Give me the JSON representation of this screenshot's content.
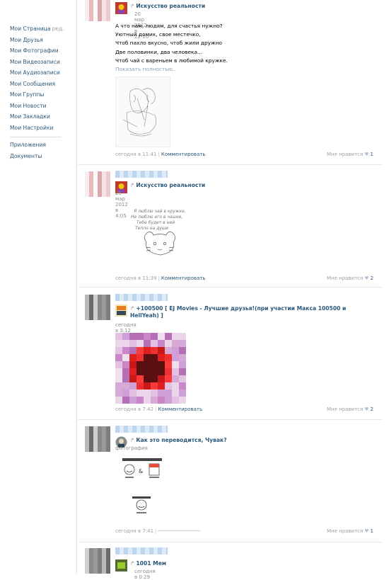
{
  "sidebar": {
    "items": [
      {
        "label": "Мои Страница",
        "extra": "ред."
      },
      {
        "label": "Мои Друзья"
      },
      {
        "label": "Мои Фотографии"
      },
      {
        "label": "Мои Видеозаписи"
      },
      {
        "label": "Мои Аудиозаписи"
      },
      {
        "label": "Мои Сообщения"
      },
      {
        "label": "Мои Группы"
      },
      {
        "label": "Мои Новости"
      },
      {
        "label": "Мои Закладки"
      },
      {
        "label": "Мои Настройки"
      }
    ],
    "secondary": [
      {
        "label": "Приложения"
      },
      {
        "label": "Документы"
      }
    ]
  },
  "posts": [
    {
      "repost_title": "Искусство реальности",
      "repost_date": "20 мар 2012 в 22:10",
      "text_lines": [
        "А что нам, людям, для счастья нужно?",
        "Уютный домик, свое местечко,",
        "Чтоб пахло вкусно, чтоб жили дружно",
        "Две половинки, два человека...",
        "Чтоб чай с вареньем в любимой кружке."
      ],
      "show_more": "Показать полностью..",
      "date": "сегодня в 11:41",
      "comment": "Комментировать",
      "like_label": "Мне нравится",
      "like_count": "1"
    },
    {
      "repost_title": "Искусство реальности",
      "repost_date": "25 мар 2012 в 4:05",
      "image_text": [
        "Я люблю чай в кружке,",
        "Не люблю его в чашке,",
        "Тебе будет в ней",
        "Тепло на душе"
      ],
      "date": "сегодня в 11:39",
      "comment": "Комментировать",
      "like_label": "Мне нравится",
      "like_count": "2"
    },
    {
      "repost_title": "+100500 [ EJ Movies - Лучшие друзья!(при участии Макса 100500 и HellYeah) ]",
      "repost_date": "сегодня в 3:12",
      "date": "сегодня в 7:42",
      "comment": "Комментировать",
      "like_label": "Мне нравится",
      "like_count": "2"
    },
    {
      "repost_title": "Как это переводится, Чувак?",
      "repost_sub": "фотография",
      "date": "сегодня в 7:41",
      "like_label": "Мне нравится",
      "like_count": "1"
    },
    {
      "repost_title": "1001 Мем",
      "repost_date": "сегодня в 0:29"
    }
  ],
  "colors": {
    "link": "#2b587a",
    "muted": "#a0a0a0",
    "divider": "#dae1e8"
  }
}
